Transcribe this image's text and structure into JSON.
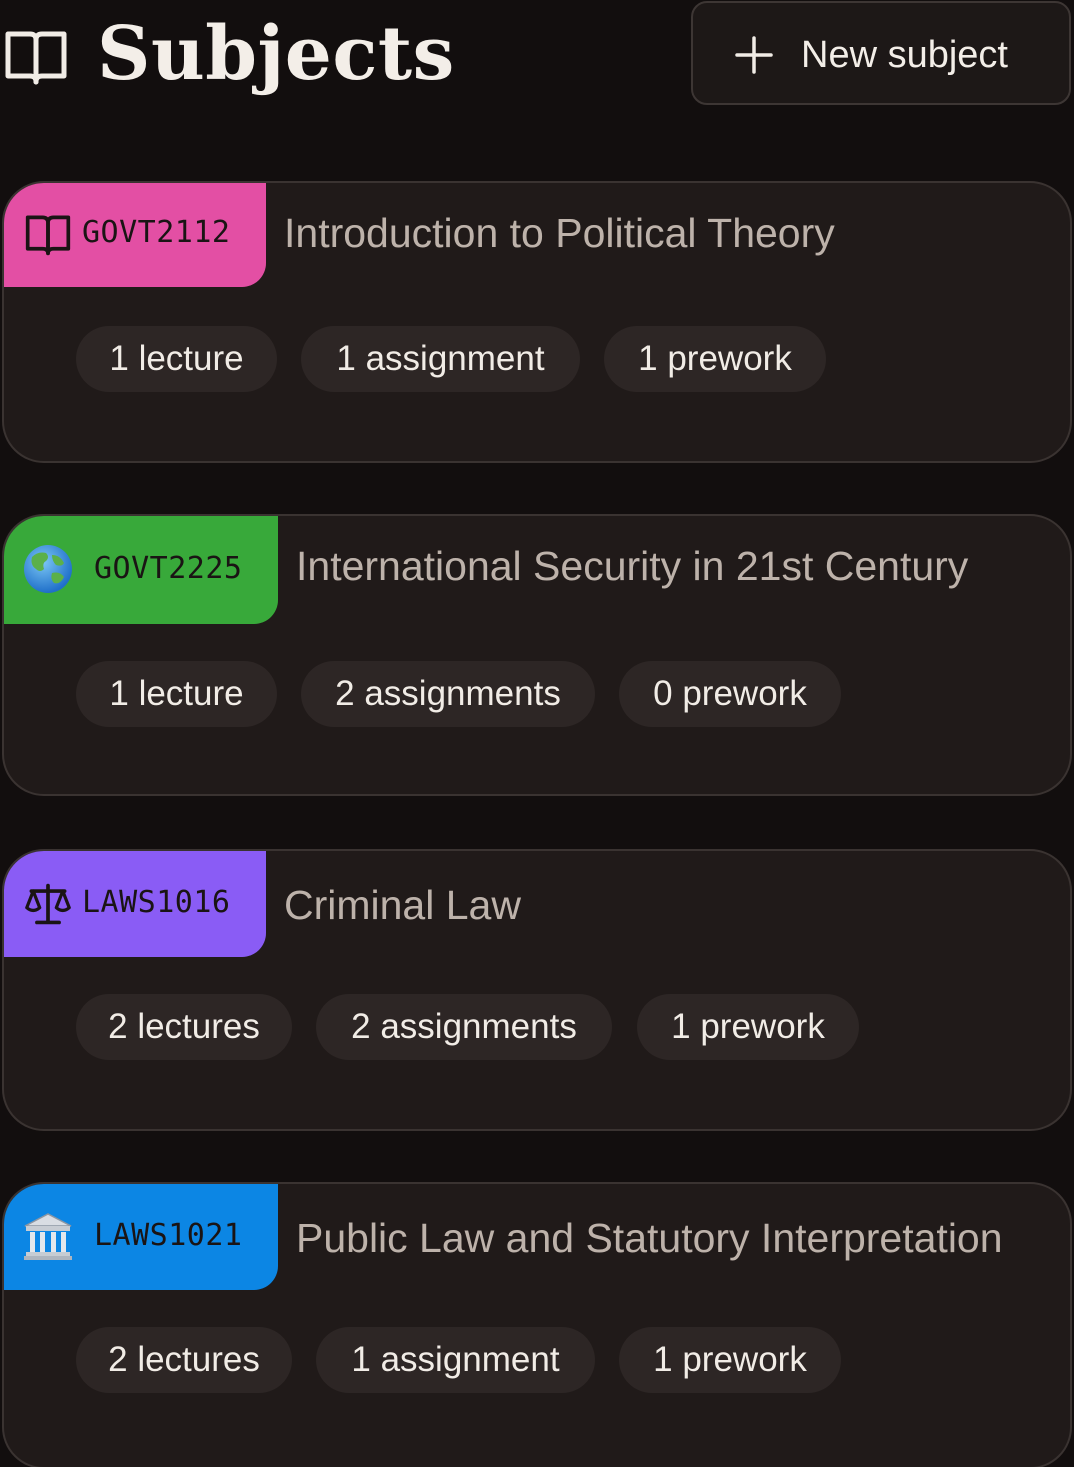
{
  "header": {
    "title": "Subjects",
    "new_button_label": "New subject"
  },
  "subjects": [
    {
      "code": "GOVT2112",
      "title": "Introduction to Political Theory",
      "icon": "open-book-icon",
      "color": "#e34fa4",
      "counts": [
        "1 lecture",
        "1 assignment",
        "1 prework"
      ]
    },
    {
      "code": "GOVT2225",
      "title": "International Security in 21st Century",
      "icon": "globe-icon",
      "color": "#38a93a",
      "counts": [
        "1 lecture",
        "2 assignments",
        "0 prework"
      ]
    },
    {
      "code": "LAWS1016",
      "title": "Criminal Law",
      "icon": "scales-icon",
      "color": "#8a5cf5",
      "counts": [
        "2 lectures",
        "2 assignments",
        "1 prework"
      ]
    },
    {
      "code": "LAWS1021",
      "title": "Public Law and Statutory Interpretation",
      "icon": "courthouse-icon",
      "color": "#0c86e4",
      "counts": [
        "2 lectures",
        "1 assignment",
        "1 prework"
      ]
    }
  ]
}
